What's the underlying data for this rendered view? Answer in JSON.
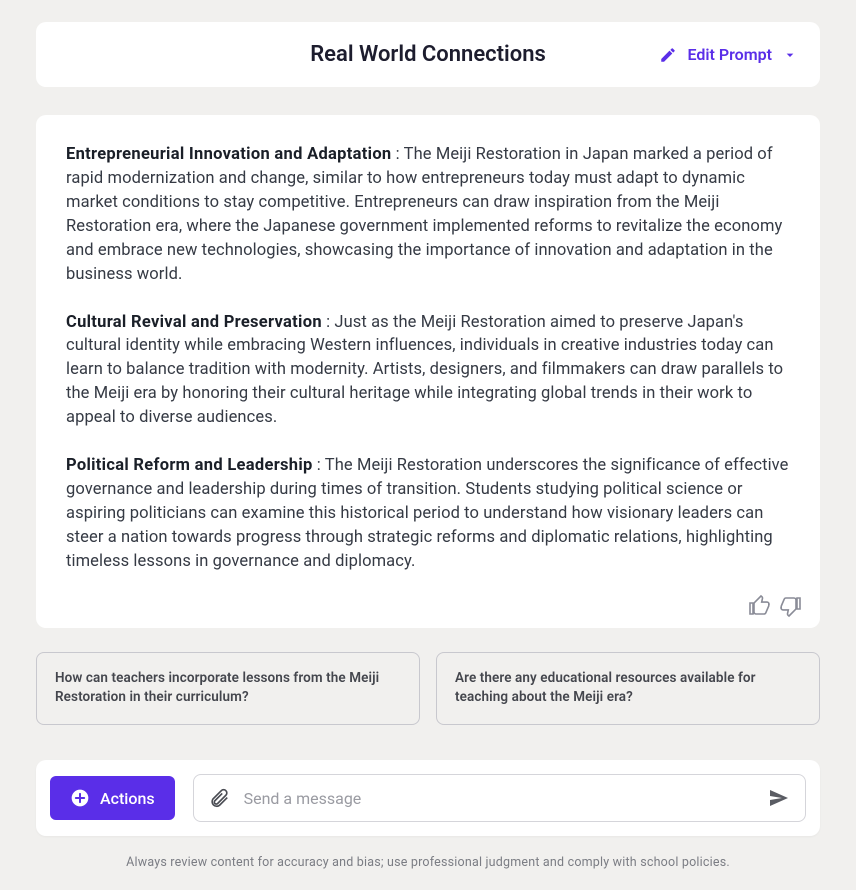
{
  "header": {
    "title": "Real World Connections",
    "edit_label": "Edit Prompt"
  },
  "content": {
    "paragraphs": [
      {
        "heading": "Entrepreneurial Innovation and Adaptation",
        "body": " : The Meiji Restoration in Japan marked a period of rapid modernization and change, similar to how entrepreneurs today must adapt to dynamic market conditions to stay competitive. Entrepreneurs can draw inspiration from the Meiji Restoration era, where the Japanese government implemented reforms to revitalize the economy and embrace new technologies, showcasing the importance of innovation and adaptation in the business world."
      },
      {
        "heading": "Cultural Revival and Preservation",
        "body": " : Just as the Meiji Restoration aimed to preserve Japan's cultural identity while embracing Western influences, individuals in creative industries today can learn to balance tradition with modernity. Artists, designers, and filmmakers can draw parallels to the Meiji era by honoring their cultural heritage while integrating global trends in their work to appeal to diverse audiences."
      },
      {
        "heading": "Political Reform and Leadership",
        "body": " : The Meiji Restoration underscores the significance of effective governance and leadership during times of transition. Students studying political science or aspiring politicians can examine this historical period to understand how visionary leaders can steer a nation towards progress through strategic reforms and diplomatic relations, highlighting timeless lessons in governance and diplomacy."
      }
    ]
  },
  "suggestions": [
    "How can teachers incorporate lessons from the Meiji Restoration in their curriculum?",
    "Are there any educational resources available for teaching about the Meiji era?"
  ],
  "input": {
    "actions_label": "Actions",
    "placeholder": "Send a message"
  },
  "footer": {
    "disclaimer": "Always review content for accuracy and bias; use professional judgment and comply with school policies."
  },
  "colors": {
    "accent": "#5a2ee8",
    "background": "#f1f0ee"
  }
}
